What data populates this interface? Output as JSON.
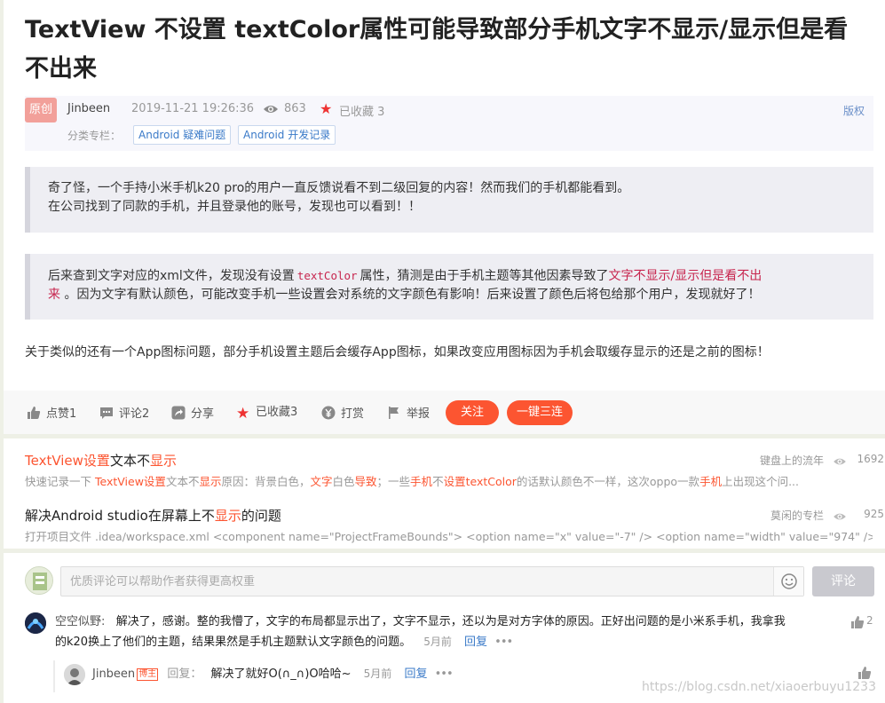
{
  "article": {
    "title": "TextView 不设置 textColor属性可能导致部分手机文字不显示/显示但是看不出来",
    "badge": "原创",
    "author": "Jinbeen",
    "date": "2019-11-21 19:26:36",
    "views": "863",
    "favorite": "已收藏 3",
    "copyright": "版权",
    "category_label": "分类专栏：",
    "categories": [
      "Android 疑难问题",
      "Android 开发记录"
    ],
    "quote1": {
      "line1": "奇了怪，一个手持小米手机k20 pro的用户一直反馈说看不到二级回复的内容！然而我们的手机都能看到。",
      "line2": "在公司找到了同款的手机，并且登录他的账号，发现也可以看到！！"
    },
    "quote2": {
      "part1": "后来查到文字对应的xml文件，发现没有设置",
      "code": "textColor",
      "part2": "属性，猜测是由于手机主题等其他因素导致了",
      "highlight1": "文字不显示/显示但是看不出",
      "highlight2": "来",
      "part3": "。因为文字有默认颜色，可能改变手机一些设置会对系统的文字颜色有影响！后来设置了颜色后将包给那个用户，发现就好了！"
    },
    "paragraph": "关于类似的还有一个App图标问题，部分手机设置主题后会缓存App图标，如果改变应用图标因为手机会取缓存显示的还是之前的图标！"
  },
  "toolbar": {
    "like": "点赞1",
    "comment": "评论2",
    "share": "分享",
    "collected": "已收藏3",
    "reward": "打赏",
    "report": "举报",
    "follow": "关注",
    "triple": "一键三连"
  },
  "recommendations": [
    {
      "title_parts": [
        [
          "TextView设置",
          "red"
        ],
        [
          "文本不",
          ""
        ],
        [
          "显示",
          "red"
        ]
      ],
      "author": "键盘上的流年",
      "views": "1692",
      "desc_parts": [
        [
          "快速记录一下 ",
          ""
        ],
        [
          "TextView设置",
          "red"
        ],
        [
          "文本不",
          ""
        ],
        [
          "显示",
          "red"
        ],
        [
          "原因：背景白色，",
          ""
        ],
        [
          "文字",
          "red"
        ],
        [
          "白色",
          ""
        ],
        [
          "导致",
          "red"
        ],
        [
          "；一些",
          ""
        ],
        [
          "手机",
          "red"
        ],
        [
          "不",
          ""
        ],
        [
          "设置textColor",
          "red"
        ],
        [
          "的话默认颜色不一样，这次oppo一款",
          ""
        ],
        [
          "手机",
          "red"
        ],
        [
          "上出现这个问...",
          ""
        ]
      ]
    },
    {
      "title_parts": [
        [
          "解决Android studio在屏幕上不",
          ""
        ],
        [
          "显示",
          "red"
        ],
        [
          "的问题",
          ""
        ]
      ],
      "author": "莫闲的专栏",
      "views": "925",
      "desc_parts": [
        [
          "打开项目文件 .idea/workspace.xml <component name=\"ProjectFrameBounds\"> <option name=\"x\" value=\"-7\" /> <option name=\"width\" value=\"974\" /> <o...",
          ""
        ]
      ]
    }
  ],
  "comment_box": {
    "placeholder": "优质评论可以帮助作者获得更高权重",
    "submit": "评论"
  },
  "comments": [
    {
      "user": "空空似野:",
      "text_line1": "解决了，感谢。整的我懵了，文字的布局都显示出了，文字不显示，还以为是对方字体的原因。正好出问题的是小米系手机，我拿我",
      "text_line2": "的k20换上了他们的主题，结果果然是手机主题默认文字颜色的问题。",
      "time": "5月前",
      "reply": "回复",
      "more": "•••",
      "likes": "2"
    },
    {
      "user": "Jinbeen",
      "host_badge": "博主",
      "reply_label": "回复：",
      "text": "解决了就好O(∩_∩)O哈哈~",
      "time": "5月前",
      "reply": "回复",
      "more": "•••"
    }
  ],
  "watermark": "https://blog.csdn.net/xiaoerbuyu1233"
}
